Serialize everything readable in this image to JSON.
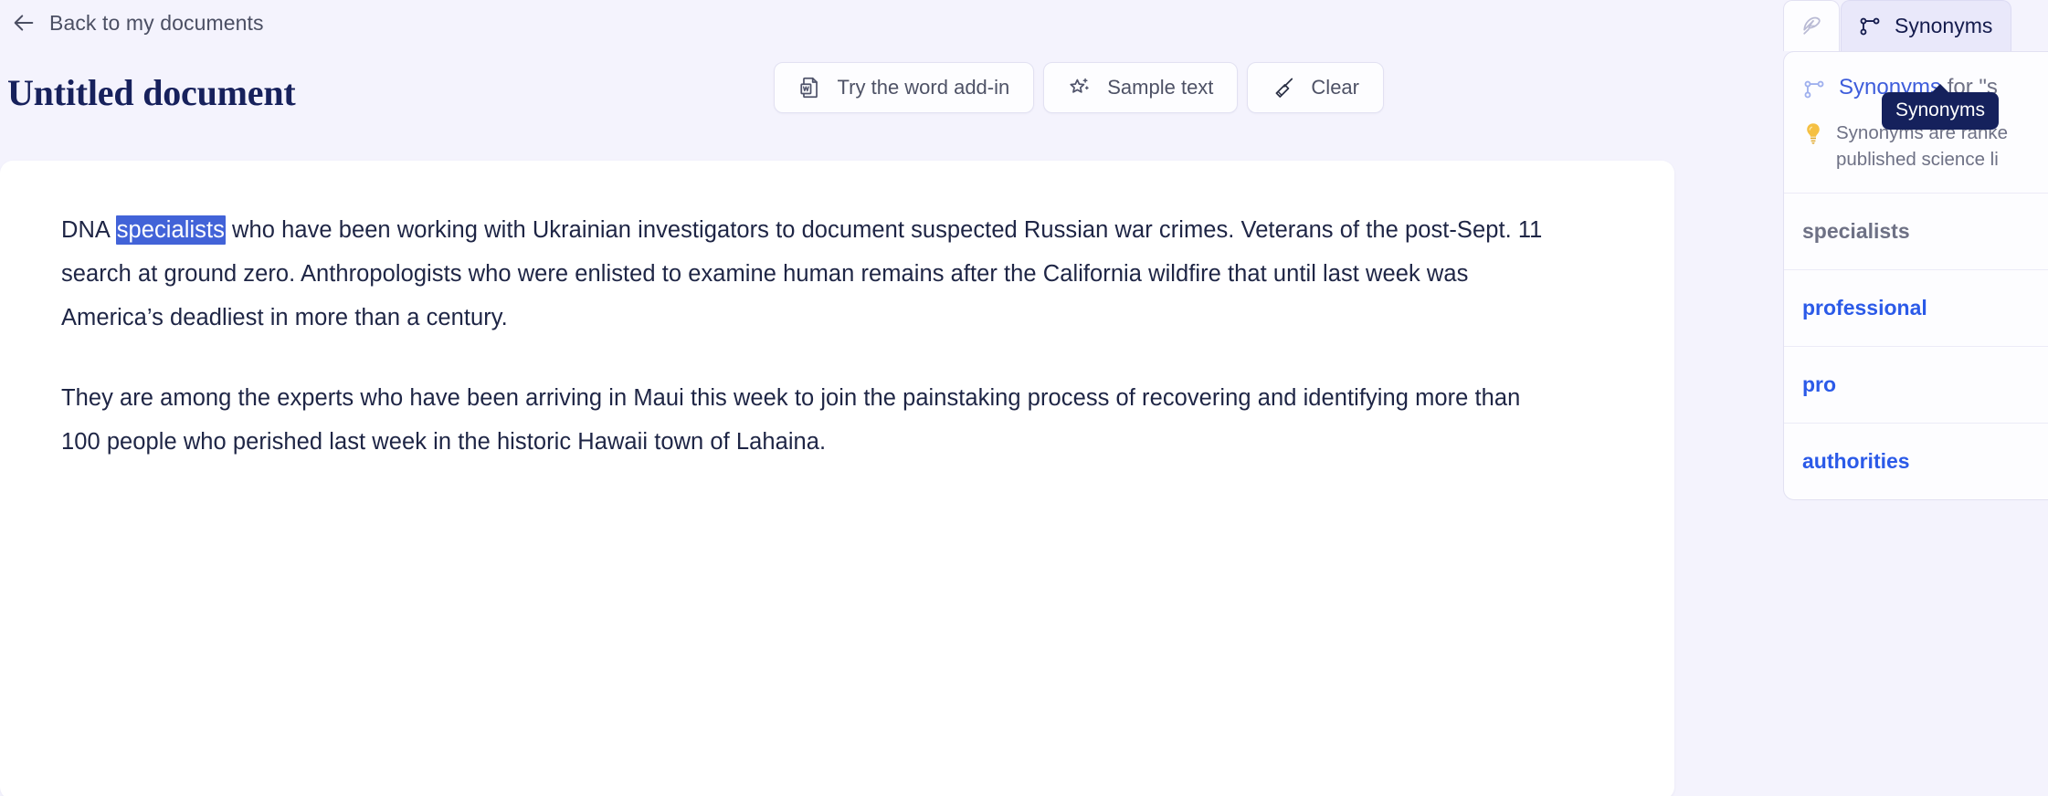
{
  "header": {
    "back_label": "Back to my documents",
    "back_icon": "arrow-left-icon",
    "document_title": "Untitled document"
  },
  "toolbar": {
    "buttons": [
      {
        "label": "Try the word add-in",
        "icon": "word-document-icon"
      },
      {
        "label": "Sample text",
        "icon": "sparkle-star-icon"
      },
      {
        "label": "Clear",
        "icon": "broom-icon"
      }
    ]
  },
  "document": {
    "paragraph1": {
      "before": "DNA ",
      "selected": "specialists",
      "after": " who have been working with Ukrainian investigators to document suspected Russian war crimes. Veterans of the post-Sept. 11 search at ground zero. Anthropologists who were enlisted to examine human remains after the California wildfire that until last week was America’s deadliest in more than a century."
    },
    "paragraph2": "They are among the experts who have been arriving in Maui this week to join the painstaking process of recovering and identifying more than 100 people who perished last week in the historic Hawaii town of Lahaina."
  },
  "right_panel": {
    "tabs": [
      {
        "label": "",
        "icon": "feather-icon",
        "active": false
      },
      {
        "label": "Synonyms",
        "icon": "branch-node-icon",
        "active": true
      }
    ],
    "tooltip": "Synonyms",
    "panel_heading_strong": "Synonyms",
    "panel_heading_muted": " for \"s",
    "panel_heading_icon": "branch-node-icon",
    "hint_icon": "lightbulb-icon",
    "hint_line1": "Synonyms are ranke",
    "hint_line2": "published science li",
    "synonyms": [
      {
        "word": "specialists",
        "type": "current"
      },
      {
        "word": "professional",
        "type": "alternative"
      },
      {
        "word": "pro",
        "type": "alternative"
      },
      {
        "word": "authorities",
        "type": "alternative"
      }
    ]
  },
  "colors": {
    "page_background": "#f4f3fd",
    "card_background": "#ffffff",
    "title_navy": "#17215c",
    "selection_blue": "#4263d8",
    "synonym_blue": "#2b5ae8",
    "tooltip_navy": "#15215c",
    "muted_text": "#6e7185",
    "tab_active_background": "#e9e8fa"
  }
}
